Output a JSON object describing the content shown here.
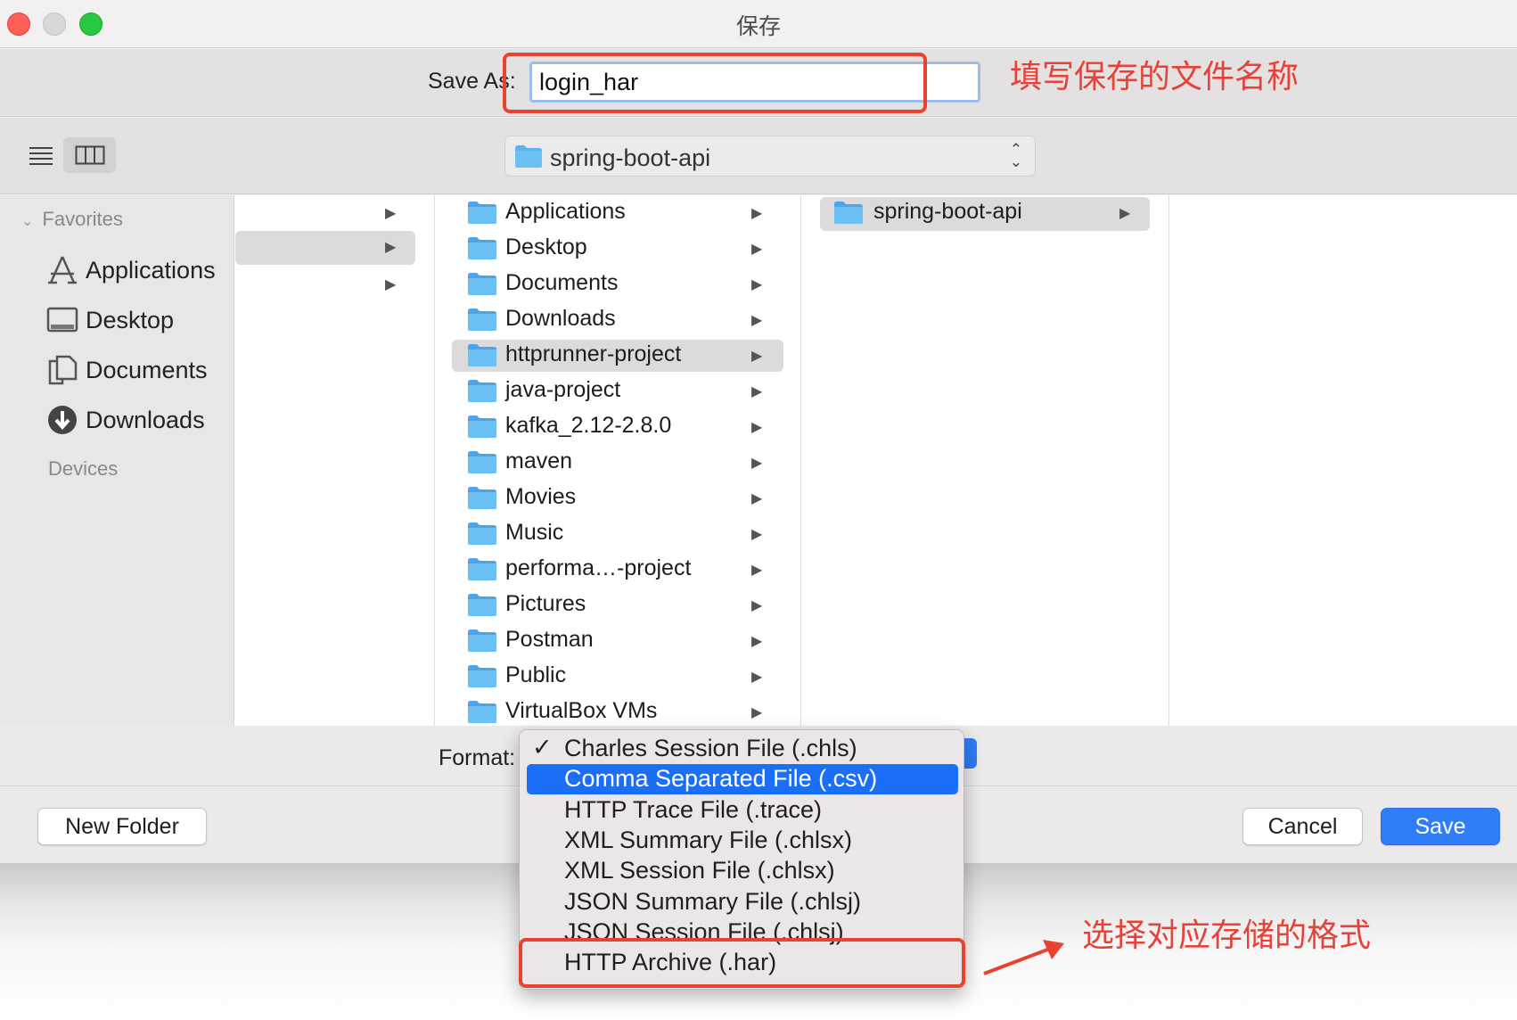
{
  "window": {
    "title": "保存"
  },
  "save_as": {
    "label": "Save As:",
    "value": "login_har"
  },
  "annotations": {
    "filename_note": "填写保存的文件名称",
    "format_note": "选择对应存储的格式",
    "color": "#e8432f"
  },
  "location": {
    "label": "spring-boot-api"
  },
  "sidebar": {
    "favorites_header": "Favorites",
    "devices_header": "Devices",
    "items": [
      {
        "label": "Applications",
        "icon": "applications-icon"
      },
      {
        "label": "Desktop",
        "icon": "desktop-icon"
      },
      {
        "label": "Documents",
        "icon": "documents-icon"
      },
      {
        "label": "Downloads",
        "icon": "downloads-icon"
      }
    ]
  },
  "column2": {
    "items": [
      "Applications",
      "Desktop",
      "Documents",
      "Downloads",
      "httprunner-project",
      "java-project",
      "kafka_2.12-2.8.0",
      "maven",
      "Movies",
      "Music",
      "performa…-project",
      "Pictures",
      "Postman",
      "Public",
      "VirtualBox VMs"
    ],
    "selected_index": 4
  },
  "column3": {
    "items": [
      "spring-boot-api"
    ]
  },
  "format": {
    "label": "Format:",
    "options": [
      "Charles Session File (.chls)",
      "Comma Separated File (.csv)",
      "HTTP Trace File (.trace)",
      "XML Summary File (.chlsx)",
      "XML Session File (.chlsx)",
      "JSON Summary File (.chlsj)",
      "JSON Session File (.chlsj)",
      "HTTP Archive (.har)"
    ],
    "checked_index": 0,
    "highlighted_index": 1
  },
  "buttons": {
    "new_folder": "New Folder",
    "cancel": "Cancel",
    "save": "Save"
  },
  "colors": {
    "accent": "#2f7ef8",
    "folder": "#5ab4ef",
    "menu_highlight": "#1a6ff6"
  }
}
